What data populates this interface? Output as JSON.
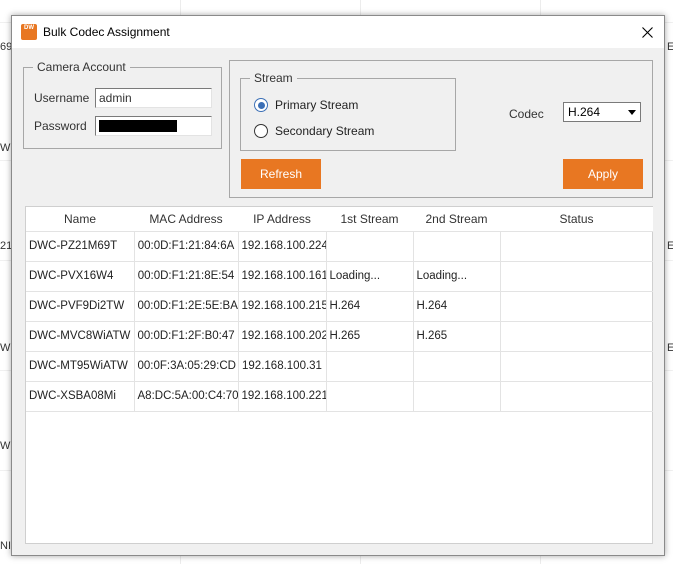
{
  "background_fragments": [
    "69",
    "W",
    "21",
    "Wi",
    "Wi",
    "NI",
    "E",
    "E",
    "E"
  ],
  "dialog": {
    "title": "Bulk Codec Assignment",
    "app_icon_text": "DW",
    "close_glyph": "×"
  },
  "camera_account": {
    "legend": "Camera Account",
    "username_label": "Username",
    "username_value": "admin",
    "password_label": "Password"
  },
  "stream": {
    "legend": "Stream",
    "options": [
      {
        "label": "Primary Stream",
        "checked": true
      },
      {
        "label": "Secondary Stream",
        "checked": false
      }
    ]
  },
  "codec": {
    "label": "Codec",
    "selected": "H.264"
  },
  "buttons": {
    "refresh": "Refresh",
    "apply": "Apply"
  },
  "table": {
    "columns": [
      "Name",
      "MAC Address",
      "IP Address",
      "1st Stream",
      "2nd Stream",
      "Status"
    ],
    "rows": [
      [
        "DWC-PZ21M69T",
        "00:0D:F1:21:84:6A",
        "192.168.100.224",
        "",
        "",
        ""
      ],
      [
        "DWC-PVX16W4",
        "00:0D:F1:21:8E:54",
        "192.168.100.161",
        "Loading...",
        "Loading...",
        ""
      ],
      [
        "DWC-PVF9Di2TW",
        "00:0D:F1:2E:5E:BA",
        "192.168.100.215",
        "H.264",
        "H.264",
        ""
      ],
      [
        "DWC-MVC8WiATW",
        "00:0D:F1:2F:B0:47",
        "192.168.100.202",
        "H.265",
        "H.265",
        ""
      ],
      [
        "DWC-MT95WiATW",
        "00:0F:3A:05:29:CD",
        "192.168.100.31",
        "",
        "",
        ""
      ],
      [
        "DWC-XSBA08Mi",
        "A8:DC:5A:00:C4:70",
        "192.168.100.221",
        "",
        "",
        ""
      ]
    ]
  },
  "colors": {
    "accent": "#e87722",
    "radio_checked": "#3b6fb6",
    "dialog_bg": "#f0f0f0"
  }
}
